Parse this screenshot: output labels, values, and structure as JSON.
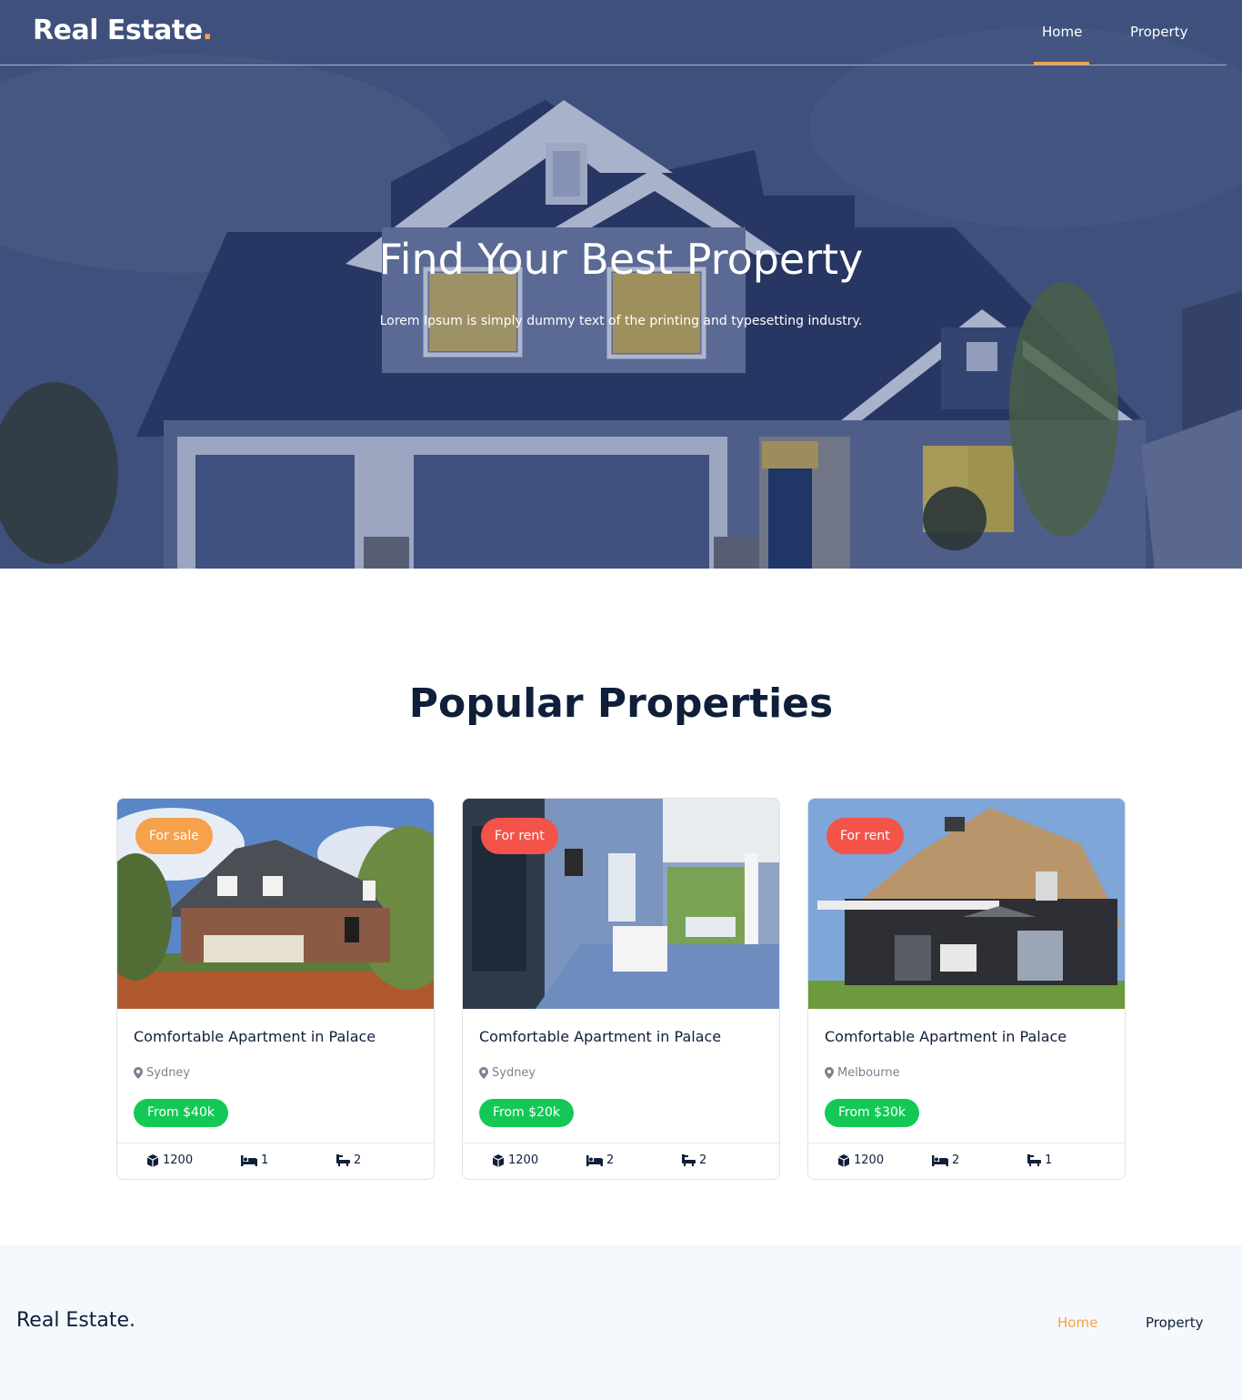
{
  "header": {
    "brand": "Real Estate",
    "brand_dot": ".",
    "nav": {
      "home": "Home",
      "property": "Property"
    },
    "active": "Home"
  },
  "hero": {
    "title": "Find Your Best Property",
    "subtitle": "Lorem Ipsum is simply dummy text of the printing and typesetting industry."
  },
  "section": {
    "title": "Popular Properties"
  },
  "properties": [
    {
      "badge": "For sale",
      "title": "Comfortable Apartment in Palace",
      "location": "Sydney",
      "price": "From $40k",
      "area": "1200",
      "beds": "1",
      "baths": "2"
    },
    {
      "badge": "For rent",
      "title": "Comfortable Apartment in Palace",
      "location": "Sydney",
      "price": "From $20k",
      "area": "1200",
      "beds": "2",
      "baths": "2"
    },
    {
      "badge": "For rent",
      "title": "Comfortable Apartment in Palace",
      "location": "Melbourne",
      "price": "From $30k",
      "area": "1200",
      "beds": "2",
      "baths": "1"
    }
  ],
  "footer": {
    "brand": "Real Estate.",
    "nav": {
      "home": "Home",
      "property": "Property"
    }
  },
  "colors": {
    "accent": "#f6a14b",
    "sale_badge": "#f6a14b",
    "rent_badge": "#f4534a",
    "price_badge": "#14c855",
    "navy": "#0f1f3a"
  },
  "icons": [
    "map-marker-icon",
    "cube-area-icon",
    "bed-icon",
    "bath-icon"
  ]
}
